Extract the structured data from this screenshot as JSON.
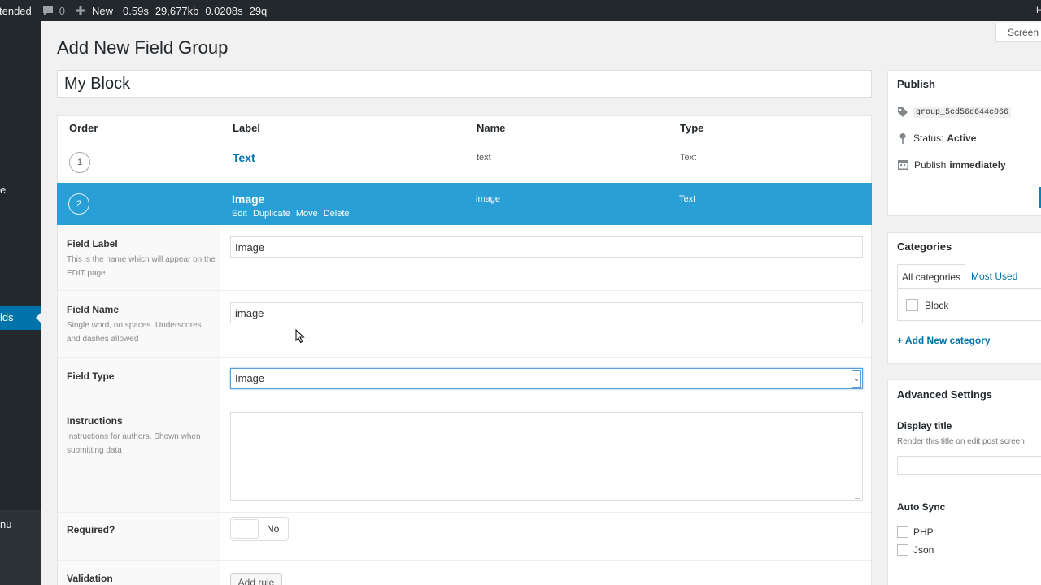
{
  "admin_bar": {
    "site_fragment": "tended",
    "comments_count": "0",
    "new_label": "New",
    "stats": [
      "0.59s",
      "29,677kb",
      "0.0208s",
      "29q"
    ]
  },
  "admin_menu": {
    "fragment_top": "e",
    "current_item_fragment": "lds",
    "collapse_fragment": "nu"
  },
  "page": {
    "title": "Add New Field Group",
    "screen_options": "Screen O",
    "field_group_title": "My Block"
  },
  "fields_table": {
    "headers": {
      "order": "Order",
      "label": "Label",
      "name": "Name",
      "type": "Type"
    },
    "rows": [
      {
        "order": "1",
        "label": "Text",
        "name": "text",
        "type": "Text"
      },
      {
        "order": "2",
        "label": "Image",
        "name": "image",
        "type": "Text"
      }
    ],
    "row_actions": [
      "Edit",
      "Duplicate",
      "Move",
      "Delete"
    ]
  },
  "field_settings": {
    "field_label": {
      "label": "Field Label",
      "desc": "This is the name which will appear on the EDIT page",
      "value": "Image"
    },
    "field_name": {
      "label": "Field Name",
      "desc": "Single word, no spaces. Underscores and dashes allowed",
      "value": "image"
    },
    "field_type": {
      "label": "Field Type",
      "value": "Image"
    },
    "instructions": {
      "label": "Instructions",
      "desc": "Instructions for authors. Shown when submitting data",
      "value": ""
    },
    "required": {
      "label": "Required?",
      "value": "No"
    },
    "validation": {
      "label": "Validation",
      "button": "Add rule"
    }
  },
  "sidebar": {
    "publish": {
      "title": "Publish",
      "group_key": "group_5cd56d644c066",
      "status_label": "Status:",
      "status_value": "Active",
      "publish_label": "Publish",
      "publish_value": "immediately"
    },
    "categories": {
      "title": "Categories",
      "tab_all": "All categories",
      "tab_most_used": "Most Used",
      "items": [
        "Block"
      ],
      "add_new": "+ Add New category"
    },
    "advanced": {
      "title": "Advanced Settings",
      "display_title_label": "Display title",
      "display_title_desc": "Render this title on edit post screen",
      "auto_sync_label": "Auto Sync",
      "sync_options": [
        "PHP",
        "Json"
      ]
    }
  },
  "colors": {
    "admin_dark": "#23282d",
    "accent": "#0073aa",
    "selected_row": "#2a9fd6"
  }
}
